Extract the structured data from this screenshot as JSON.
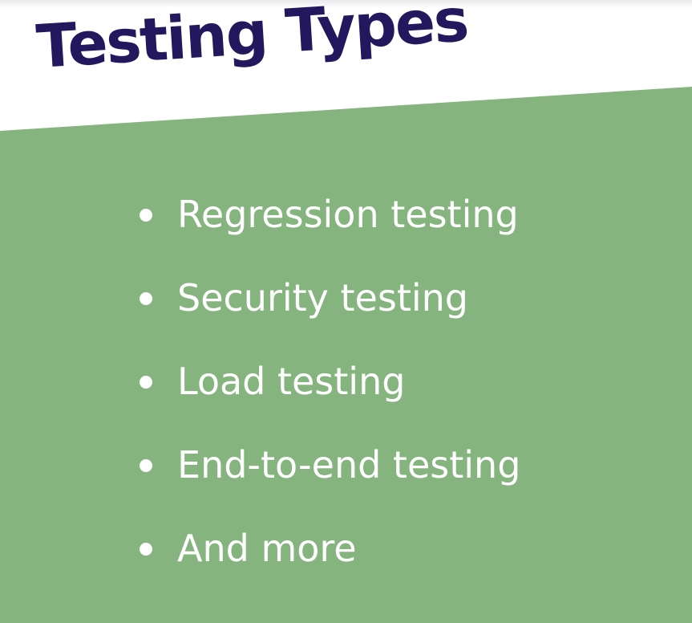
{
  "slide": {
    "title": "Testing Types",
    "bullets": [
      "Regression testing",
      "Security testing",
      "Load testing",
      "End-to-end testing",
      "And more"
    ]
  },
  "colors": {
    "title": "#23185e",
    "panel": "#86b47f",
    "background": "#ffffff",
    "bullet_text": "#ffffff"
  }
}
